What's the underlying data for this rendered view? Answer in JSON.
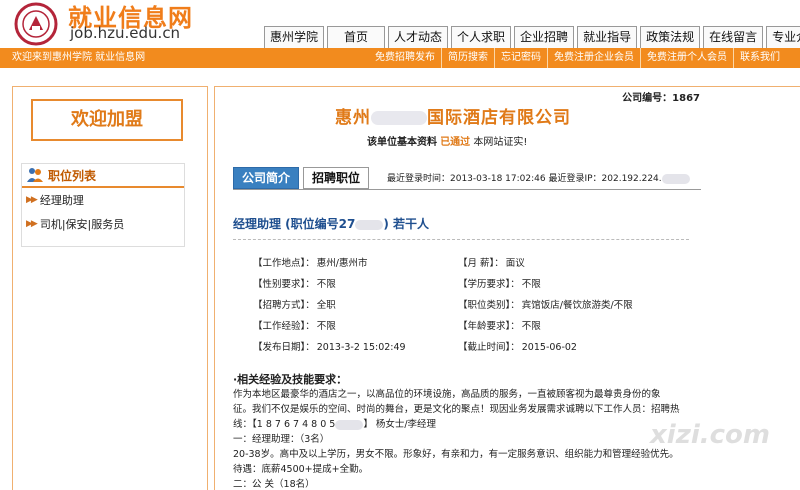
{
  "header": {
    "site_name": "就业信息网",
    "site_url": "job.hzu.edu.cn",
    "nav": [
      "惠州学院",
      "首页",
      "人才动态",
      "个人求职",
      "企业招聘",
      "就业指导",
      "政策法规",
      "在线留言",
      "专业介绍"
    ]
  },
  "strip": {
    "welcome": "欢迎来到惠州学院 就业信息网",
    "links": [
      "免费招聘发布",
      "简历搜索",
      "忘记密码",
      "免费注册企业会员",
      "免费注册个人会员",
      "联系我们"
    ]
  },
  "left": {
    "join": "欢迎加盟",
    "job_list_title": "职位列表",
    "jobs": [
      "经理助理",
      "司机|保安|服务员"
    ]
  },
  "company": {
    "id_label": "公司编号：1867",
    "name_prefix": "惠州",
    "name_suffix": "国际酒店有限公司",
    "verify_prefix": "该单位基本资料",
    "verify_status": "已通过",
    "verify_suffix": "本网站证实!"
  },
  "tabs": {
    "intro": "公司简介",
    "jobs": "招聘职位",
    "login_info": "最近登录时间：2013-03-18 17:02:46  最近登录IP：202.192.224."
  },
  "post": {
    "title_prefix": "经理助理 (职位编号27",
    "title_suffix": ") 若干人",
    "fields": [
      [
        "【工作地点】：",
        "惠州/惠州市",
        "【月    薪】：",
        "面议"
      ],
      [
        "【性别要求】：",
        "不限",
        "【学历要求】：",
        "不限"
      ],
      [
        "【招聘方式】：",
        "全职",
        "【职位类别】：",
        "宾馆饭店/餐饮旅游类/不限"
      ],
      [
        "【工作经验】：",
        "不限",
        "【年龄要求】：",
        "不限"
      ],
      [
        "【发布日期】：",
        "2013-3-2 15:02:49",
        "【截止时间】：",
        "2015-06-02"
      ]
    ]
  },
  "requirements": {
    "heading": "·相关经验及技能要求：",
    "line1": "    作为本地区最豪华的酒店之一，以高品位的环境设施，高品质的服务，一直被顾客视为最尊贵身份的象",
    "line2": "征。我们不仅是娱乐的空间、时尚的舞台，更是文化的聚点！现因业务发展需求诚聘以下工作人员：招聘热",
    "line3_prefix": "线：【1 8 7 6 7 4 8 0 5",
    "line3_suffix": "】 杨女士/李经理",
    "line4": "一：经理助理：（3名）",
    "line5": "20-38岁。高中及以上学历，男女不限。形象好，有亲和力，有一定服务意识、组织能力和管理经验优先。",
    "line6": "待遇：底薪4500+提成+全勤。",
    "line7": "二：公 关（18名）"
  },
  "watermark": "xizi.com"
}
